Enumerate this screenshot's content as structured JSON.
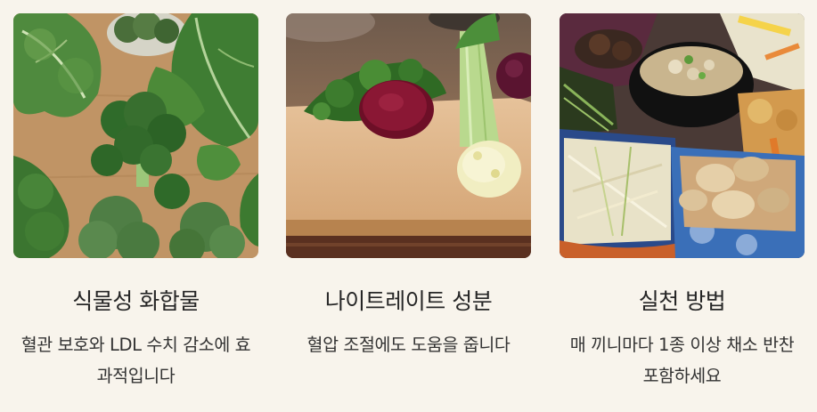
{
  "cards": [
    {
      "image": "leafy-greens-and-broccoli-photo",
      "title": "식물성 화합물",
      "description": "혈관 보호와 LDL 수치 감소에 효과적입니다"
    },
    {
      "image": "beet-celery-cutting-board-photo",
      "title": "나이트레이트 성분",
      "description": "혈압 조절에도 도움을 줍니다"
    },
    {
      "image": "korean-side-dishes-platter-photo",
      "title": "실천 방법",
      "description": "매 끼니마다 1종 이상 채소 반찬 포함하세요"
    }
  ],
  "colors": {
    "background": "#f8f4ec",
    "text": "#262626"
  }
}
